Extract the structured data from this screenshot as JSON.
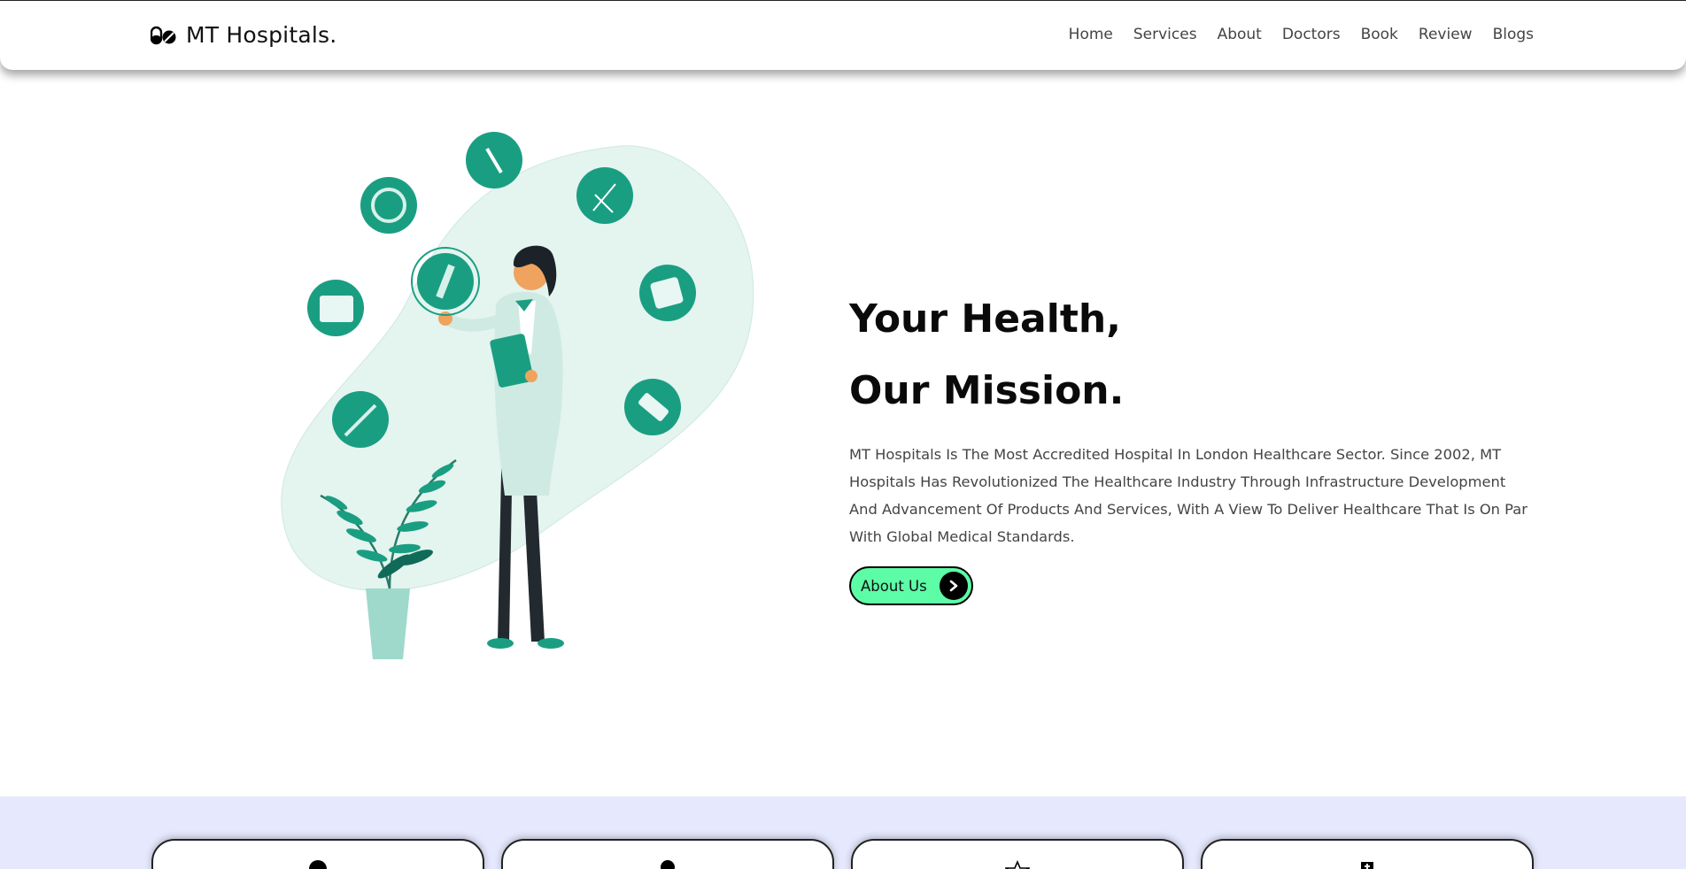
{
  "brand": {
    "name": "MT Hospitals.",
    "icon": "pills-icon"
  },
  "nav": {
    "items": [
      "Home",
      "Services",
      "About",
      "Doctors",
      "Book",
      "Review",
      "Blogs"
    ]
  },
  "hero": {
    "headline_line1": "Your Health,",
    "headline_line2": "Our Mission.",
    "description": "MT Hospitals Is The Most Accredited Hospital In London Healthcare Sector. Since 2002, MT Hospitals Has Revolutionized The Healthcare Industry Through Infrastructure Development And Advancement Of Products And Services, With A View To Deliver Healthcare That Is On Par With Global Medical Standards.",
    "button_label": "About Us",
    "button_icon": "chevron-right-icon",
    "illustration": "doctor-illustration"
  },
  "colors": {
    "accent": "#5dfca6",
    "teal": "#1a9e82",
    "band": "#e6e9fd"
  },
  "services": {
    "card_icons": [
      "user-icon",
      "user-icon",
      "star-icon",
      "clinic-icon"
    ]
  }
}
